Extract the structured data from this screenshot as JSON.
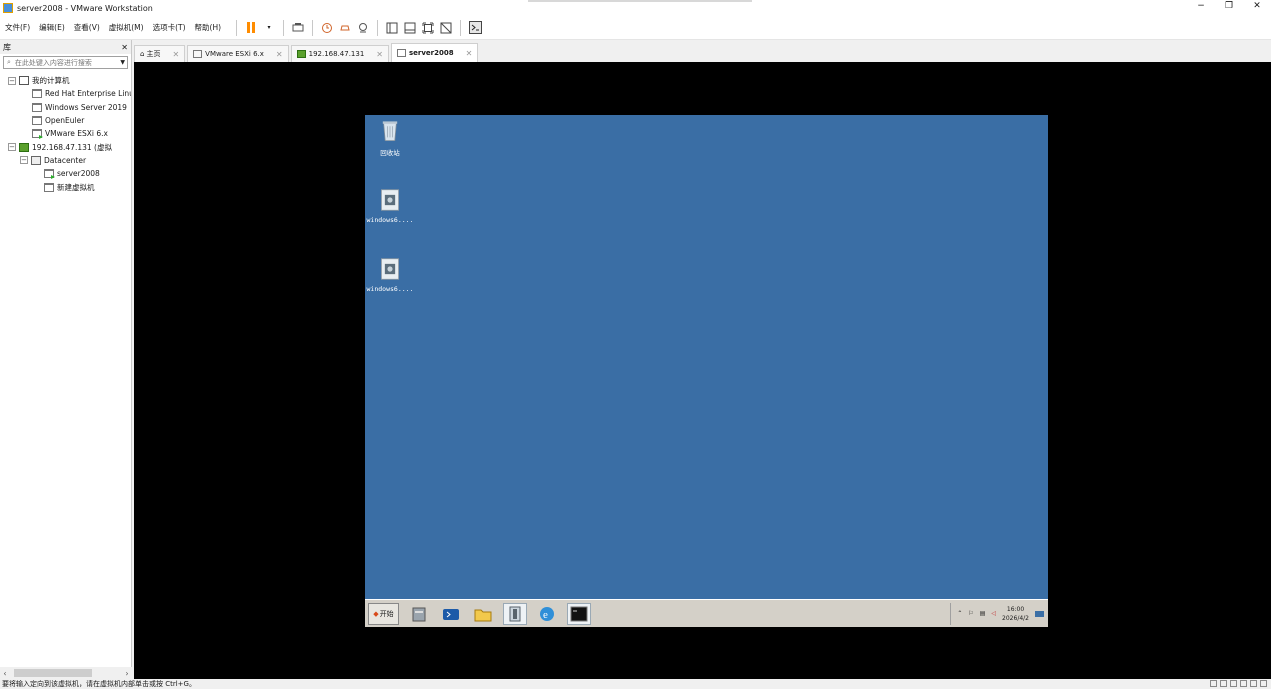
{
  "window": {
    "title": "server2008 - VMware Workstation",
    "controls": [
      "−",
      "❐",
      "✕"
    ]
  },
  "menu": [
    "文件(F)",
    "编辑(E)",
    "查看(V)",
    "虚拟机(M)",
    "选项卡(T)",
    "帮助(H)"
  ],
  "library": {
    "title": "库",
    "close": "✕",
    "search_placeholder": "在此处键入内容进行搜索",
    "tree": {
      "my_computer": "我的计算机",
      "vms": [
        "Red Hat Enterprise Linux",
        "Windows Server 2019",
        "OpenEuler",
        "VMware ESXi 6.x"
      ],
      "host": "192.168.47.131 (虚拟",
      "datacenter": "Datacenter",
      "dc_vms": [
        "server2008",
        "新建虚拟机"
      ]
    }
  },
  "tabs": [
    {
      "label": "主页",
      "active": false
    },
    {
      "label": "VMware ESXi 6.x",
      "active": false
    },
    {
      "label": "192.168.47.131",
      "active": false
    },
    {
      "label": "server2008",
      "active": true
    }
  ],
  "guest": {
    "desktop_icons": [
      "回收站",
      "windows6....",
      "windows6...."
    ],
    "start_label": "开始",
    "clock_time": "16:00",
    "clock_date": "2026/4/2"
  },
  "status": {
    "text": "要将输入定向到该虚拟机，请在虚拟机内部单击或按 Ctrl+G。"
  },
  "colors": {
    "desktop": "#3a6ea5",
    "pause": "#ff8c00"
  }
}
